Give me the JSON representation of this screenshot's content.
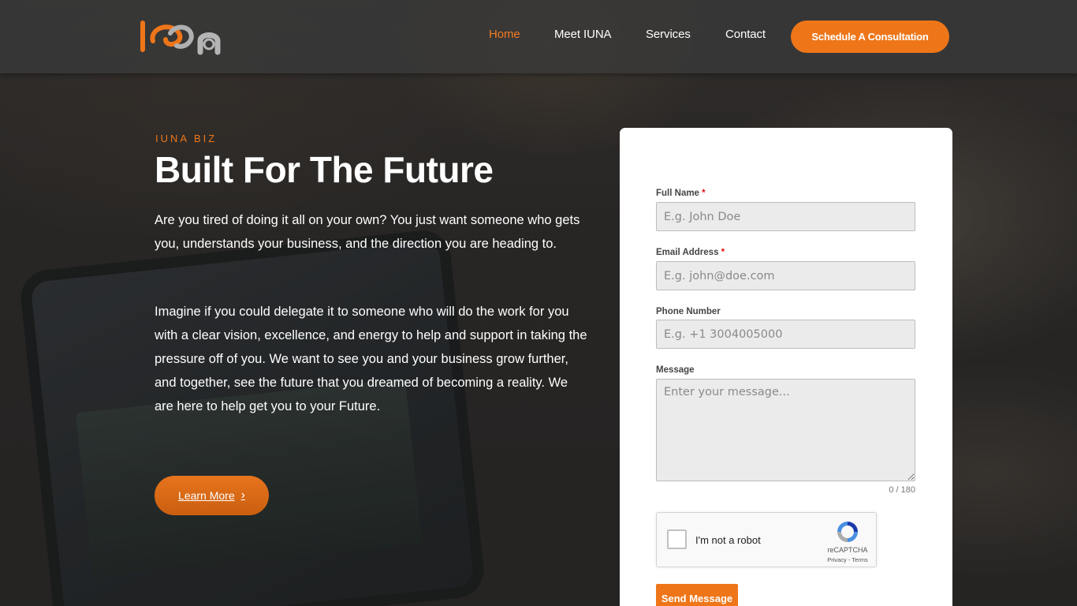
{
  "header": {
    "nav": [
      {
        "label": "Home",
        "active": true
      },
      {
        "label": "Meet IUNA",
        "active": false
      },
      {
        "label": "Services",
        "active": false
      },
      {
        "label": "Contact",
        "active": false
      }
    ],
    "cta_label": "Schedule A Consultation"
  },
  "hero": {
    "eyebrow": "IUNA BIZ",
    "title": "Built For The Future",
    "paragraph_1": "Are you tired of doing it all on your own? You just want someone who gets you, understands your business, and the direction you are heading to.",
    "paragraph_2": "Imagine if you could delegate it to someone who will do the work for you with a clear vision, excellence, and energy to help and support in taking the pressure off of you. We want to see you and your business grow further, and together, see the future that you dreamed of becoming a reality. We are here to help get you to your Future.",
    "learn_more_label": "Learn More"
  },
  "form": {
    "full_name": {
      "label": "Full Name",
      "required_mark": "*",
      "placeholder": "E.g. John Doe"
    },
    "email": {
      "label": "Email Address",
      "required_mark": "*",
      "placeholder": "E.g. john@doe.com"
    },
    "phone": {
      "label": "Phone Number",
      "placeholder": "E.g. +1 3004005000"
    },
    "message": {
      "label": "Message",
      "placeholder": "Enter your message..."
    },
    "counter": "0 / 180",
    "recaptcha": {
      "label": "I'm not a robot",
      "brand": "reCAPTCHA",
      "links": "Privacy - Terms"
    },
    "submit_label": "Send Message"
  },
  "colors": {
    "accent": "#ee7619",
    "header_bg": "#3a3a3a",
    "card_bg": "#ffffff"
  },
  "icons": [
    "logo",
    "chevron-right-icon",
    "recaptcha-icon"
  ]
}
